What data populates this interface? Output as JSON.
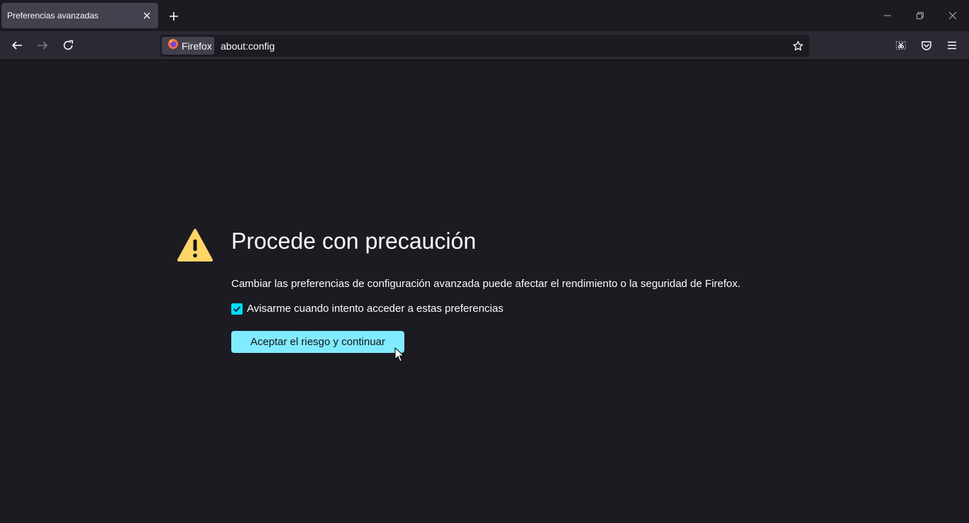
{
  "browser": {
    "tab": {
      "title": "Preferencias avanzadas"
    },
    "identity_label": "Firefox",
    "url": "about:config"
  },
  "page": {
    "heading": "Procede con precaución",
    "description": "Cambiar las preferencias de configuración avanzada puede afectar el rendimiento o la seguridad de Firefox.",
    "checkbox_label": "Avisarme cuando intento acceder a estas preferencias",
    "checkbox_checked": true,
    "accept_button": "Aceptar el riesgo y continuar"
  },
  "colors": {
    "background": "#1c1b22",
    "toolbar": "#2b2a33",
    "accent": "#80ebff",
    "checkbox": "#00ddff",
    "warning": "#ffd567"
  }
}
